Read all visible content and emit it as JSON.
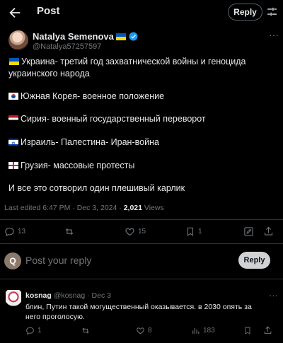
{
  "header": {
    "title": "Post",
    "reply_label": "Reply"
  },
  "author": {
    "name": "Natalya Semenova",
    "handle": "@Natalya57257597"
  },
  "post": {
    "line1": "Украина- третий год захватнической войны и геноцида  украинского народа",
    "line2": "Южная Корея- военное положение",
    "line3": "Сирия- военный государственный переворот",
    "line4": "Израиль- Палестина- Иран-война",
    "line5": "Грузия- массовые протесты",
    "line6": "И все это сотворил один плешивый карлик"
  },
  "meta": {
    "edited": "Last edited 6:47 PM · Dec 3, 2024 · ",
    "views_count": "2,021",
    "views_label": " Views"
  },
  "actions": {
    "replies": "13",
    "likes": "15",
    "bookmarks": "1"
  },
  "composer": {
    "avatar_letter": "Q",
    "placeholder": "Post your reply",
    "button": "Reply"
  },
  "comment": {
    "name": "kosnag",
    "handle": "@kosnag · Dec 3",
    "text": "блин, Путин такой могущественный оказывается. в 2030 опять за него проголосую.",
    "replies": "1",
    "likes": "8",
    "views": "183"
  },
  "icons": [
    "back-arrow-icon",
    "tune-icon",
    "verified-icon",
    "more-icon",
    "reply-icon",
    "retweet-icon",
    "heart-icon",
    "bookmark-icon",
    "edit-icon",
    "share-icon",
    "views-icon"
  ],
  "colors": {
    "background": "#000000",
    "text": "#e7e9ea",
    "muted": "#71767b",
    "verified": "#1d9bf0",
    "divider": "#2f3336"
  }
}
